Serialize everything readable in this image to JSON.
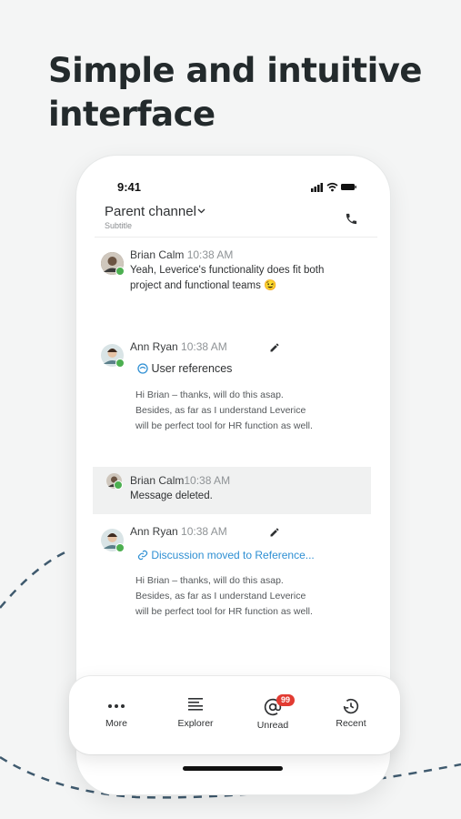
{
  "headline": {
    "line1": "Simple and intuitive",
    "line2": "interface"
  },
  "status": {
    "time": "9:41"
  },
  "channel": {
    "title": "Parent channel",
    "subtitle": "Subtitle"
  },
  "messages": [
    {
      "author": "Brian Calm",
      "time": "10:38 AM",
      "text_line1": "Yeah, Leverice's functionality does fit both",
      "text_line2": "project and functional teams 😉"
    },
    {
      "author": "Ann Ryan",
      "time": "10:38 AM",
      "reference": "User references",
      "quote_line1": "Hi Brian – thanks, will do this asap.",
      "quote_line2": "Besides, as far as I understand Leverice",
      "quote_line3": "will be perfect tool for HR function as well."
    },
    {
      "author": "Brian Calm",
      "time": "10:38 AM",
      "text": "Message deleted."
    },
    {
      "author": "Ann Ryan",
      "time": "10:38 AM",
      "link": "Discussion moved to Reference...",
      "quote_line1": "Hi Brian – thanks, will do this asap.",
      "quote_line2": "Besides, as far as I understand Leverice",
      "quote_line3": "will be perfect tool for HR function as well."
    }
  ],
  "nav": [
    {
      "label": "More",
      "icon": "more-icon"
    },
    {
      "label": "Explorer",
      "icon": "explorer-icon"
    },
    {
      "label": "Unread",
      "icon": "at-icon",
      "badge": "99"
    },
    {
      "label": "Recent",
      "icon": "recent-icon"
    }
  ],
  "colors": {
    "accent": "#2e8fd3",
    "badge": "#e23b32",
    "presence": "#4caf50",
    "dash": "#3f5a6e"
  }
}
